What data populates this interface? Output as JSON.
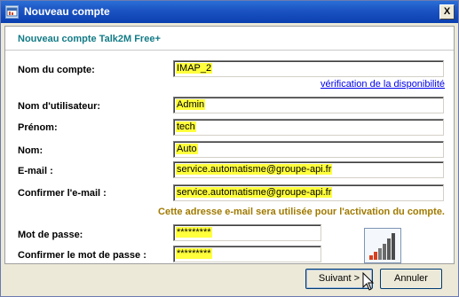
{
  "window": {
    "title": "Nouveau compte",
    "close_glyph": "X"
  },
  "subtitle": "Nouveau compte Talk2M Free+",
  "fields": {
    "account_name": {
      "label": "Nom du compte:",
      "value": "IMAP_2"
    },
    "availability_link": "vérification de la disponibilité",
    "username": {
      "label": "Nom d'utilisateur:",
      "value": "Admin"
    },
    "firstname": {
      "label": "Prénom:",
      "value": "tech"
    },
    "lastname": {
      "label": "Nom:",
      "value": "Auto"
    },
    "email": {
      "label": "E-mail :",
      "value": "service.automatisme@groupe-api.fr"
    },
    "email_confirm": {
      "label": "Confirmer l'e-mail :",
      "value": "service.automatisme@groupe-api.fr"
    },
    "email_note": "Cette adresse e-mail sera utilisée pour l'activation du compte.",
    "password": {
      "label": "Mot de passe:",
      "value": "*********"
    },
    "password_confirm": {
      "label": "Confirmer le mot de passe :",
      "value": "*********"
    }
  },
  "buttons": {
    "next": "Suivant >",
    "cancel": "Annuler"
  },
  "icons": {
    "window_icon": "app-window-icon",
    "logo": "signal-bars-logo-icon",
    "cursor": "mouse-pointer-icon"
  },
  "colors": {
    "title_bar": "#0a3fb0",
    "subtitle": "#127b86",
    "highlight": "#ffff3c",
    "note": "#a07a00",
    "link": "#0000ee"
  }
}
